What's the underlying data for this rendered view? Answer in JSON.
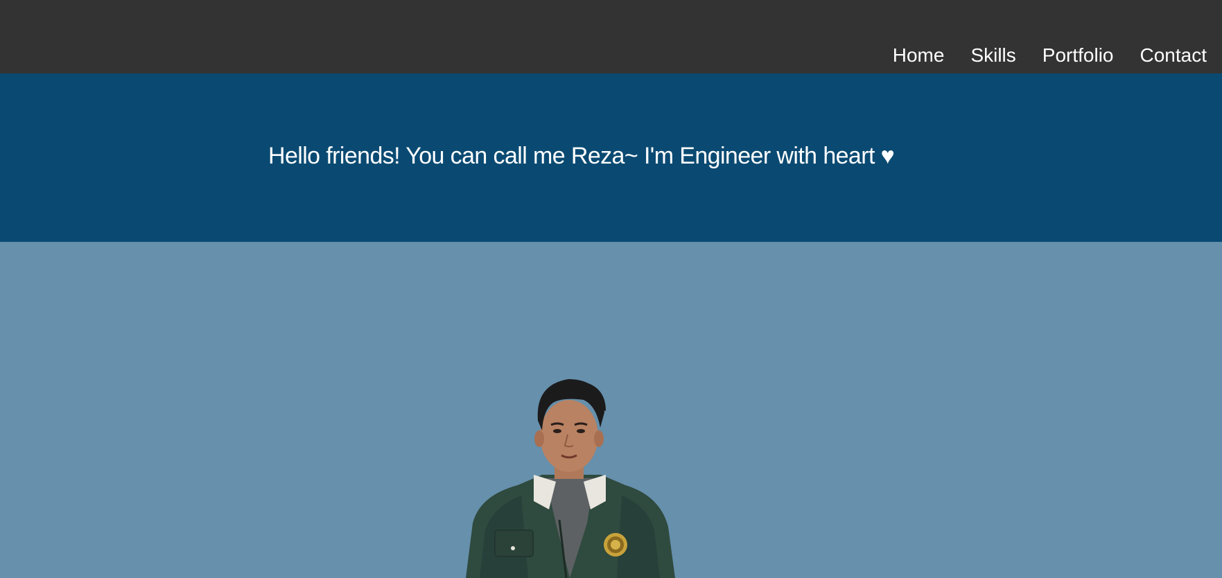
{
  "nav": {
    "items": [
      {
        "label": "Home"
      },
      {
        "label": "Skills"
      },
      {
        "label": "Portfolio"
      },
      {
        "label": "Contact"
      }
    ]
  },
  "hero": {
    "greeting": "Hello friends! You can call me Reza~ I'm Engineer with heart ♥"
  },
  "colors": {
    "topbar": "#333333",
    "hero_bg": "#0a4a72",
    "photo_bg": "#6690ac",
    "jacket": "#2f4a3e"
  }
}
